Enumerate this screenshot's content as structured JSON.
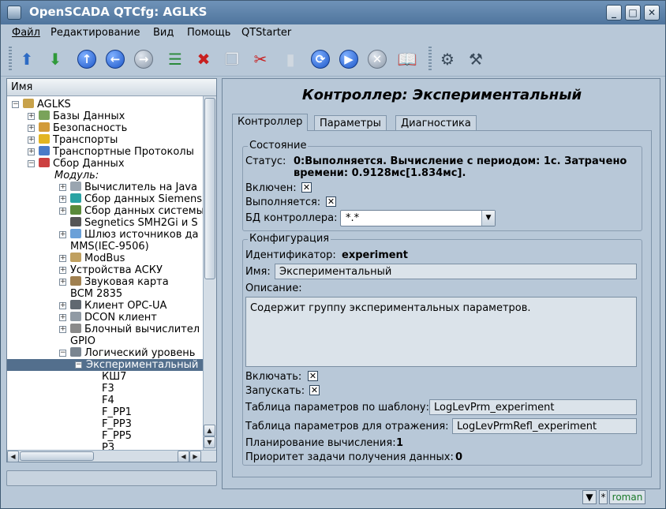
{
  "window": {
    "title": "OpenSCADA QTCfg: AGLKS"
  },
  "menu": [
    "Файл",
    "Редактирование",
    "Вид",
    "Помощь",
    "QTStarter"
  ],
  "toolbar": {
    "icons": [
      "db-load-icon",
      "db-save-icon",
      "up-icon",
      "back-icon",
      "forward-icon",
      "add-icon",
      "delete-icon",
      "copy-icon",
      "cut-icon",
      "paste-icon",
      "refresh-icon",
      "start-icon",
      "stop-icon",
      "manual-icon",
      "settings-icon",
      "settings-alt-icon"
    ]
  },
  "tree": {
    "header": "Имя",
    "rows": [
      {
        "label": "AGLKS",
        "depth": 0,
        "expander": "−",
        "icon": "#c8a24a"
      },
      {
        "label": "Базы Данных",
        "depth": 1,
        "expander": "+",
        "icon": "#7aa35a"
      },
      {
        "label": "Безопасность",
        "depth": 1,
        "expander": "+",
        "icon": "#d29b3a"
      },
      {
        "label": "Транспорты",
        "depth": 1,
        "expander": "+",
        "icon": "#e3b521"
      },
      {
        "label": "Транспортные Протоколы",
        "depth": 1,
        "expander": "+",
        "icon": "#4a7bc8"
      },
      {
        "label": "Сбор Данных",
        "depth": 1,
        "expander": "−",
        "icon": "#cc4040"
      },
      {
        "label": "Модуль:",
        "depth": 2,
        "expander": "",
        "icon": "",
        "italic": true
      },
      {
        "label": "Вычислитель на Java",
        "depth": 3,
        "expander": "+",
        "icon": "#9aa5b0"
      },
      {
        "label": "Сбор данных Siemens",
        "depth": 3,
        "expander": "+",
        "icon": "#2aa3a3"
      },
      {
        "label": "Сбор данных системы",
        "depth": 3,
        "expander": "+",
        "icon": "#5a8a3a"
      },
      {
        "label": "Segnetics SMH2Gi и S",
        "depth": 3,
        "expander": "",
        "icon": "#555555"
      },
      {
        "label": "Шлюз источников да",
        "depth": 3,
        "expander": "+",
        "icon": "#6aa0d8"
      },
      {
        "label": "MMS(IEC-9506)",
        "depth": 3,
        "expander": "",
        "icon": ""
      },
      {
        "label": "ModBus",
        "depth": 3,
        "expander": "+",
        "icon": "#c0a060"
      },
      {
        "label": "Устройства АСКУ",
        "depth": 3,
        "expander": "+",
        "icon": ""
      },
      {
        "label": "Звуковая карта",
        "depth": 3,
        "expander": "+",
        "icon": "#a08050"
      },
      {
        "label": "BCM 2835",
        "depth": 3,
        "expander": "",
        "icon": ""
      },
      {
        "label": "Клиент OPC-UA",
        "depth": 3,
        "expander": "+",
        "icon": "#606870"
      },
      {
        "label": "DCON клиент",
        "depth": 3,
        "expander": "+",
        "icon": "#909aa4"
      },
      {
        "label": "Блочный вычислител",
        "depth": 3,
        "expander": "+",
        "icon": "#8a8a8a"
      },
      {
        "label": "GPIO",
        "depth": 3,
        "expander": "",
        "icon": ""
      },
      {
        "label": "Логический уровень",
        "depth": 3,
        "expander": "−",
        "icon": "#7a8590"
      },
      {
        "label": "Экспериментальный",
        "depth": 4,
        "expander": "−",
        "icon": "",
        "selected": true
      },
      {
        "label": "КШ7",
        "depth": 5,
        "expander": "",
        "icon": ""
      },
      {
        "label": "F3",
        "depth": 5,
        "expander": "",
        "icon": ""
      },
      {
        "label": "F4",
        "depth": 5,
        "expander": "",
        "icon": ""
      },
      {
        "label": "F_PP1",
        "depth": 5,
        "expander": "",
        "icon": ""
      },
      {
        "label": "F_PP3",
        "depth": 5,
        "expander": "",
        "icon": ""
      },
      {
        "label": "F_PP5",
        "depth": 5,
        "expander": "",
        "icon": ""
      },
      {
        "label": "P3",
        "depth": 5,
        "expander": "",
        "icon": ""
      }
    ]
  },
  "page": {
    "title": "Контроллер: Экспериментальный",
    "tabs": [
      "Контроллер",
      "Параметры",
      "Диагностика"
    ],
    "state": {
      "legend": "Состояние",
      "status_label": "Статус:",
      "status_line1": "0:Выполняется. Вычисление с периодом: 1с. Затрачено",
      "status_line2": "времени: 0.9128мс[1.834мс].",
      "enabled_label": "Включен:",
      "running_label": "Выполняется:",
      "db_label": "БД контроллера:",
      "db_value": "*.*"
    },
    "config": {
      "legend": "Конфигурация",
      "id_label": "Идентификатор:",
      "id_value": "experiment",
      "name_label": "Имя:",
      "name_value": "Экспериментальный",
      "descr_label": "Описание:",
      "descr_value": "Содержит группу экспериментальных параметров.",
      "enable_label": "Включать:",
      "start_label": "Запускать:",
      "prm_tbl_label": "Таблица параметров по шаблону:",
      "prm_tbl_value": "LogLevPrm_experiment",
      "refl_tbl_label": "Таблица параметров для отражения:",
      "refl_tbl_value": "LogLevPrmRefl_experiment",
      "sched_label": "Планирование вычисления:",
      "sched_value": "1",
      "prior_label": "Приоритет задачи получения данных:",
      "prior_value": "0"
    }
  },
  "statusbar": {
    "mode": "*",
    "user": "roman"
  }
}
